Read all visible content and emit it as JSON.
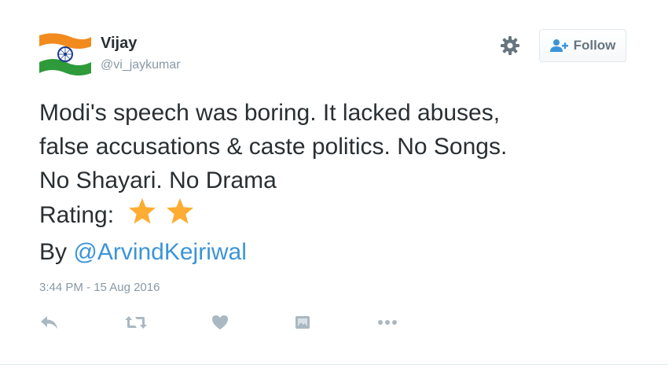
{
  "user": {
    "display_name": "Vijay",
    "handle": "@vi_jaykumar",
    "avatar_icon": "indian-flag-avatar"
  },
  "header": {
    "settings_icon": "gear-icon",
    "follow_label": "Follow",
    "follow_icon": "add-user-icon"
  },
  "tweet": {
    "lines": [
      "Modi's speech was boring. It lacked abuses,",
      "false accusations & caste politics. No Songs.",
      "No Shayari. No Drama"
    ],
    "rating_label": "Rating:",
    "rating_stars": 2,
    "by_label": "By",
    "mention": "@ArvindKejriwal",
    "timestamp": "3:44 PM - 15 Aug 2016"
  },
  "actions": [
    {
      "icon": "reply-icon"
    },
    {
      "icon": "retweet-icon"
    },
    {
      "icon": "like-icon"
    },
    {
      "icon": "moments-icon"
    },
    {
      "icon": "more-icon"
    }
  ],
  "colors": {
    "link": "#3b94d9",
    "meta": "#8899a6",
    "text": "#292f33",
    "star": "#ffac33",
    "icon": "#aab8c2"
  }
}
